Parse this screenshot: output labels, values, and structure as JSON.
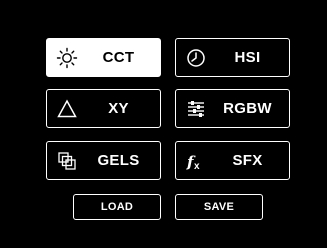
{
  "modes": [
    {
      "label": "CCT",
      "icon": "sun-icon",
      "selected": true
    },
    {
      "label": "HSI",
      "icon": "clock-icon",
      "selected": false
    },
    {
      "label": "XY",
      "icon": "triangle-icon",
      "selected": false
    },
    {
      "label": "RGBW",
      "icon": "sliders-icon",
      "selected": false
    },
    {
      "label": "GELS",
      "icon": "gel-swatches-icon",
      "selected": false
    },
    {
      "label": "SFX",
      "icon": "fx-icon",
      "selected": false
    }
  ],
  "actions": {
    "load_label": "LOAD",
    "save_label": "SAVE"
  },
  "colors": {
    "background": "#000000",
    "foreground": "#ffffff",
    "selected_background": "#ffffff",
    "selected_foreground": "#000000"
  }
}
